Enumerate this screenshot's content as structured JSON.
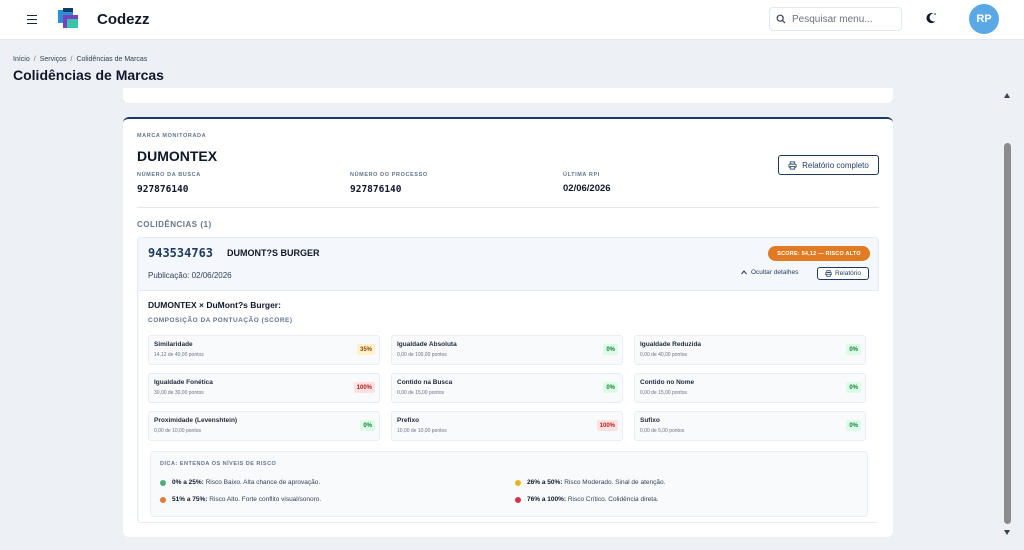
{
  "app": {
    "brand": "Codezz"
  },
  "header": {
    "search_placeholder": "Pesquisar menu...",
    "avatar_initials": "RP"
  },
  "breadcrumb": [
    "Início",
    "Serviços",
    "Colidências de Marcas"
  ],
  "page_title": "Colidências de Marcas",
  "monitored": {
    "eyebrow": "MARCA MONITORADA",
    "name": "DUMONTEX",
    "search_number_label": "NÚMERO DA BUSCA",
    "search_number": "927876140",
    "process_number_label": "NÚMERO DO PROCESSO",
    "process_number": "927876140",
    "last_rpi_label": "ÚLTIMA RPI",
    "last_rpi": "02/06/2026",
    "report_button": "Relatório completo"
  },
  "coincidences_label": "COLIDÊNCIAS (1)",
  "match": {
    "number": "943534763",
    "brand": "DUMONT?S BURGER",
    "publication": "Publicação: 02/06/2026",
    "score_badge": "SCORE: 54,12 — RISCO ALTO",
    "hide_details": "Ocultar detalhes",
    "report_button": "Relatório",
    "comparison": "DUMONTEX × DuMont?s Burger:",
    "composition_label": "COMPOSIÇÃO DA PONTUAÇÃO (SCORE)",
    "metrics": [
      {
        "name": "Similaridade",
        "points": "14,12 de 40,00 pontos",
        "badge": "35%"
      },
      {
        "name": "Igualdade Absoluta",
        "points": "0,00 de 100,00 pontos",
        "badge": "0%"
      },
      {
        "name": "Igualdade Reduzida",
        "points": "0,00 de 40,00 pontos",
        "badge": "0%"
      },
      {
        "name": "Igualdade Fonética",
        "points": "30,00 de 30,00 pontos",
        "badge": "100%"
      },
      {
        "name": "Contido na Busca",
        "points": "0,00 de 15,00 pontos",
        "badge": "0%"
      },
      {
        "name": "Contido no Nome",
        "points": "0,00 de 15,00 pontos",
        "badge": "0%"
      },
      {
        "name": "Proximidade (Levenshtein)",
        "points": "0,00 de 10,00 pontos",
        "badge": "0%"
      },
      {
        "name": "Prefixo",
        "points": "10,00 de 10,00 pontos",
        "badge": "100%"
      },
      {
        "name": "Sufixo",
        "points": "0,00 de 5,00 pontos",
        "badge": "0%"
      }
    ],
    "tip": {
      "title": "DICA: ENTENDA OS NÍVEIS DE RISCO",
      "levels": [
        {
          "range": "0% a 25%:",
          "text": "Risco Baixo. Alta chance de aprovação.",
          "color": "#4caf7a"
        },
        {
          "range": "26% a 50%:",
          "text": "Risco Moderado. Sinal de atenção.",
          "color": "#e6b422"
        },
        {
          "range": "51% a 75%:",
          "text": "Risco Alto. Forte conflito visual/sonoro.",
          "color": "#e5783a"
        },
        {
          "range": "76% a 100%:",
          "text": "Risco Crítico. Colidência direta.",
          "color": "#d6334a"
        }
      ]
    }
  },
  "colors": {
    "accent": "#1e3a5f",
    "risk_high": "#e07b24",
    "avatar": "#5ba8e6"
  }
}
